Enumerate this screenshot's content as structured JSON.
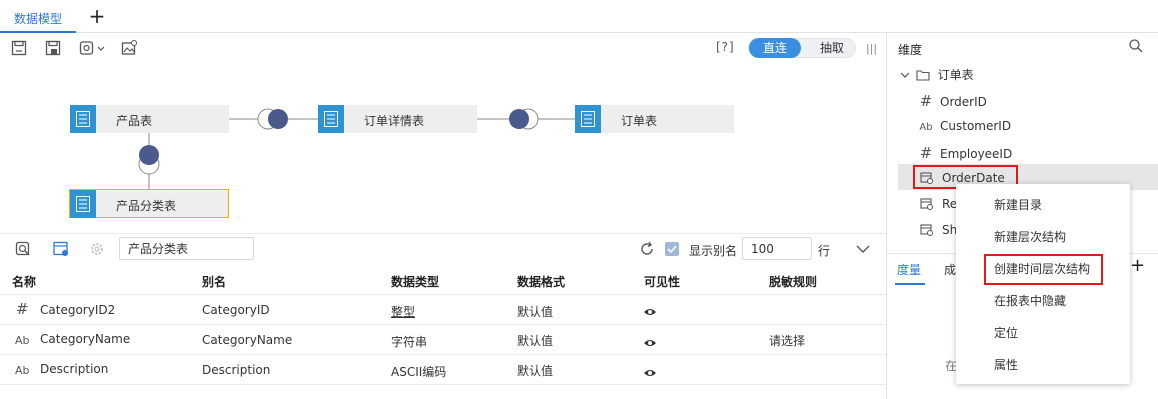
{
  "tabs": [
    {
      "label": "数据模型"
    }
  ],
  "toolbar": {
    "help": "[?]",
    "mode_direct": "直连",
    "mode_extract": "抽取"
  },
  "diagram": {
    "nodes": [
      "产品表",
      "订单详情表",
      "订单表",
      "产品分类表"
    ]
  },
  "table_toolbar": {
    "filter_value": "产品分类表",
    "show_alias_label": "显示别名",
    "rows_value": "100",
    "rows_unit": "行"
  },
  "table": {
    "headers": [
      "名称",
      "别名",
      "数据类型",
      "数据格式",
      "可见性",
      "脱敏规则"
    ],
    "rows": [
      {
        "type_icon": "#",
        "name": "CategoryID2",
        "alias": "CategoryID",
        "data_type": "整型",
        "format": "默认值",
        "masking": ""
      },
      {
        "type_icon": "Ab",
        "name": "CategoryName",
        "alias": "CategoryName",
        "data_type": "字符串",
        "format": "默认值",
        "masking": "请选择"
      },
      {
        "type_icon": "Ab",
        "name": "Description",
        "alias": "Description",
        "data_type": "ASCII编码",
        "format": "默认值",
        "masking": ""
      }
    ]
  },
  "right_panel": {
    "title": "维度",
    "table_node": "订单表",
    "fields": [
      {
        "icon": "#",
        "label": "OrderID"
      },
      {
        "icon": "Ab",
        "label": "CustomerID"
      },
      {
        "icon": "#",
        "label": "EmployeeID"
      },
      {
        "icon": "date",
        "label": "OrderDate"
      },
      {
        "icon": "date",
        "label": "Re"
      },
      {
        "icon": "date",
        "label": "Sh"
      }
    ],
    "tabs": [
      "度量",
      "成"
    ],
    "partial_text": "在"
  },
  "context_menu": {
    "items": [
      "新建目录",
      "新建层次结构",
      "创建时间层次结构",
      "在报表中隐藏",
      "定位",
      "属性"
    ]
  },
  "colors": {
    "accent": "#2b78d8",
    "node_icon": "#2d93d1",
    "connector": "#4a5a8c",
    "highlight_red": "#e0191b"
  }
}
